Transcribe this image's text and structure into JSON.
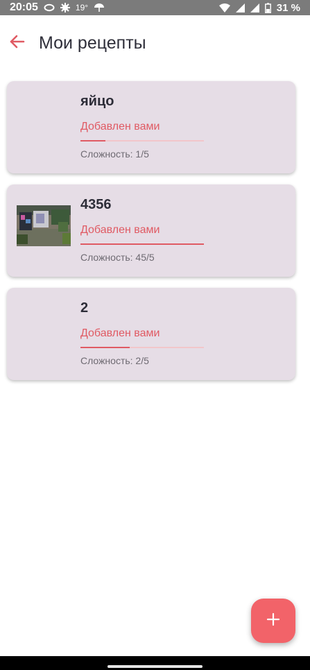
{
  "status_bar": {
    "time": "20:05",
    "temperature": "19°",
    "battery": "31 %",
    "icons": [
      "cloud-icon",
      "gear-icon",
      "umbrella-icon",
      "wifi-icon",
      "signal-icon",
      "signal-icon",
      "battery-icon"
    ]
  },
  "app_bar": {
    "back_icon": "arrow-left-icon",
    "title": "Мои рецепты"
  },
  "recipes": [
    {
      "title": "яйцо",
      "author": "Добавлен вами",
      "difficulty": "Сложность: 1/5",
      "progress": 0.2,
      "has_image": false
    },
    {
      "title": "4356",
      "author": "Добавлен вами",
      "difficulty": "Сложность: 45/5",
      "progress": 1.0,
      "has_image": true
    },
    {
      "title": "2",
      "author": "Добавлен вами",
      "difficulty": "Сложность: 2/5",
      "progress": 0.4,
      "has_image": false
    }
  ],
  "fab": {
    "icon": "plus-icon"
  },
  "colors": {
    "accent": "#e05a63",
    "card_background": "#e6dde6",
    "fab": "#f26369"
  }
}
